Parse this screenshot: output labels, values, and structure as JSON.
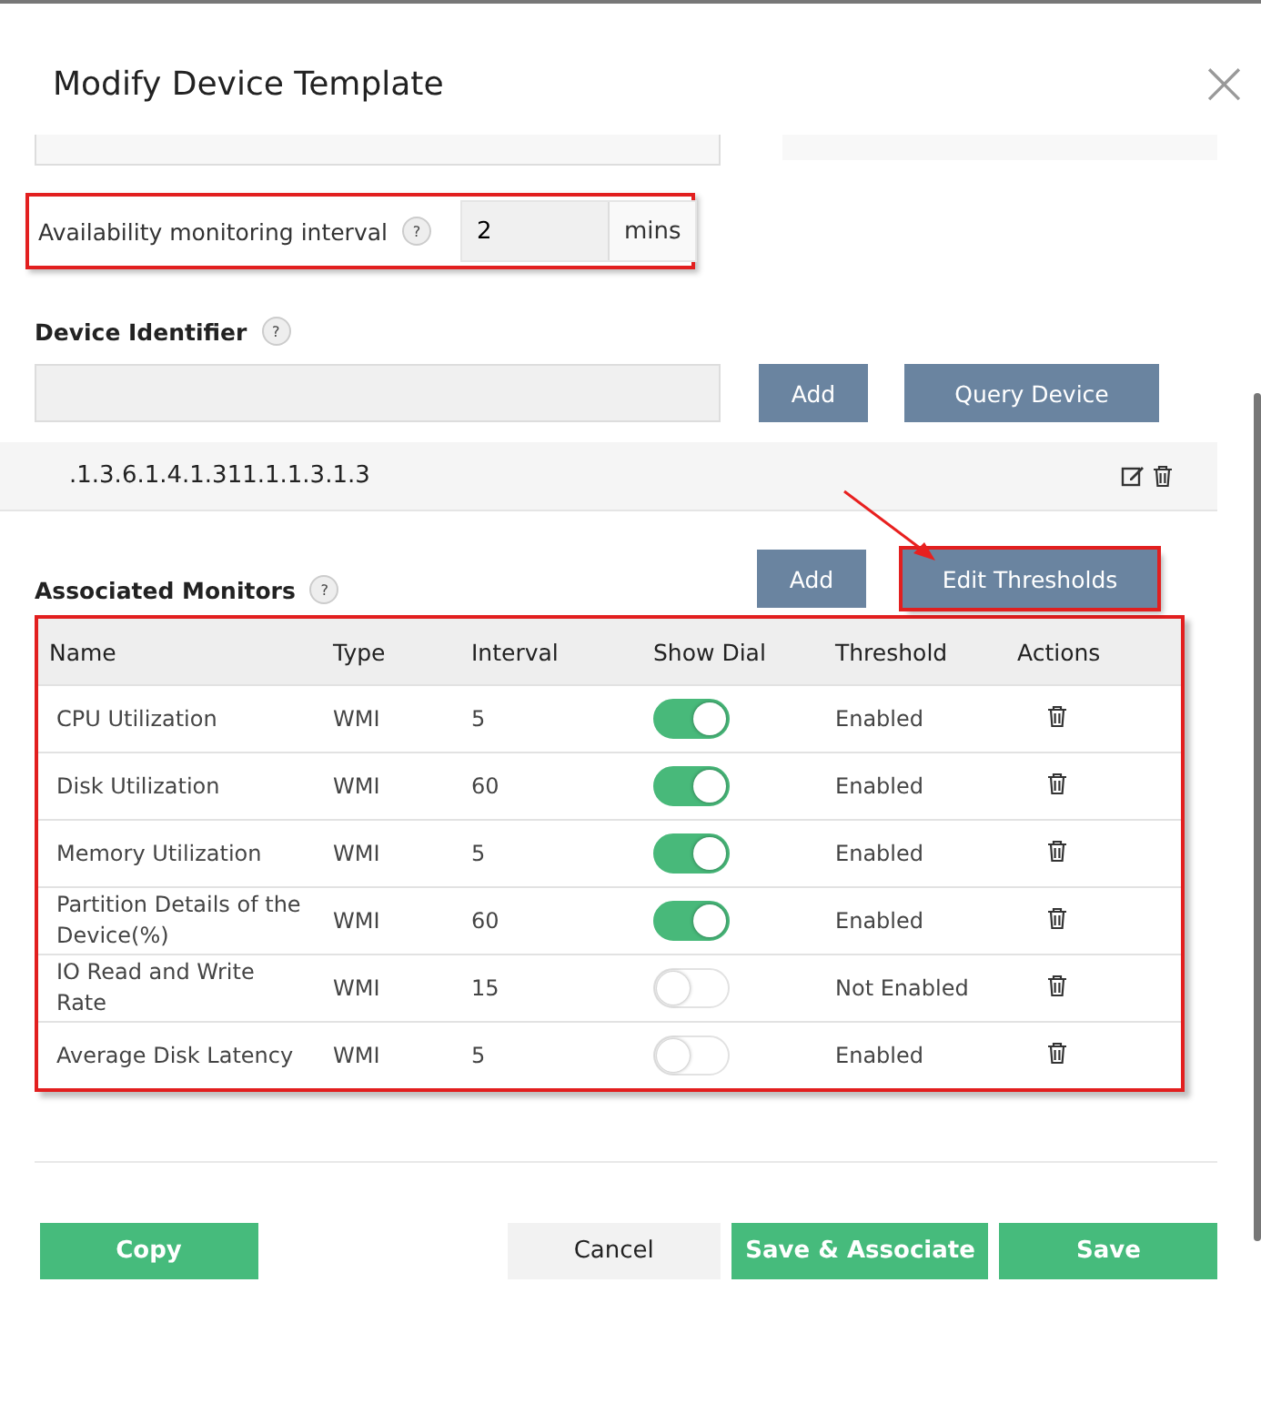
{
  "dialog": {
    "title": "Modify Device Template",
    "close": "×"
  },
  "availability": {
    "label": "Availability monitoring interval",
    "help": "?",
    "value": "2",
    "unit": "mins",
    "highlighted": true
  },
  "device_identifier": {
    "label": "Device Identifier",
    "help": "?",
    "buttons": [
      "Add",
      "Query Device"
    ],
    "oids": [
      ".1.3.6.1.4.1.311.1.1.3.1.3"
    ]
  },
  "associated_monitors": {
    "label": "Associated Monitors",
    "help": "?",
    "buttons": [
      {
        "label": "Add",
        "highlighted": false
      },
      {
        "label": "Edit Thresholds",
        "highlighted": true
      }
    ],
    "table": {
      "highlighted": true,
      "columns": [
        "Name",
        "Type",
        "Interval",
        "Show Dial",
        "Threshold",
        "Actions"
      ],
      "rows": [
        {
          "name": "CPU Utilization",
          "type": "WMI",
          "interval": "5",
          "show_dial": true,
          "threshold": "Enabled"
        },
        {
          "name": "Disk Utilization",
          "type": "WMI",
          "interval": "60",
          "show_dial": true,
          "threshold": "Enabled"
        },
        {
          "name": "Memory Utilization",
          "type": "WMI",
          "interval": "5",
          "show_dial": true,
          "threshold": "Enabled"
        },
        {
          "name": "Partition Details of the Device(%)",
          "type": "WMI",
          "interval": "60",
          "show_dial": true,
          "threshold": "Enabled"
        },
        {
          "name": "IO Read and Write Rate",
          "type": "WMI",
          "interval": "15",
          "show_dial": false,
          "threshold": "Not Enabled"
        },
        {
          "name": "Average Disk Latency",
          "type": "WMI",
          "interval": "5",
          "show_dial": false,
          "threshold": "Enabled"
        }
      ]
    }
  },
  "footer": [
    {
      "label": "Copy",
      "kind": "primary"
    },
    {
      "label": "Cancel",
      "kind": "plain"
    },
    {
      "label": "Save & Associate",
      "kind": "primary"
    },
    {
      "label": "Save",
      "kind": "primary"
    }
  ]
}
